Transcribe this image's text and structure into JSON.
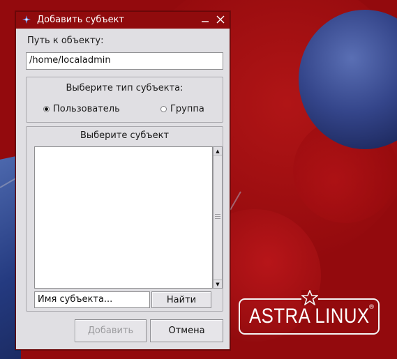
{
  "dialog": {
    "title": "Добавить субъект",
    "path_label": "Путь к объекту:",
    "path_value": "/home/localadmin",
    "type_group": {
      "heading": "Выберите тип субъекта:",
      "options": [
        {
          "label": "Пользователь",
          "checked": true
        },
        {
          "label": "Группа",
          "checked": false
        }
      ]
    },
    "subject_group": {
      "heading": "Выберите субъект",
      "search_placeholder": "Имя субъекта...",
      "find_button": "Найти"
    },
    "buttons": {
      "add": "Добавить",
      "cancel": "Отмена"
    }
  },
  "desktop": {
    "logo_text": "ASTRA LINUX",
    "logo_reg": "®",
    "wallpaper_color": "#930a0d",
    "titlebar_color": "#900b0d"
  }
}
